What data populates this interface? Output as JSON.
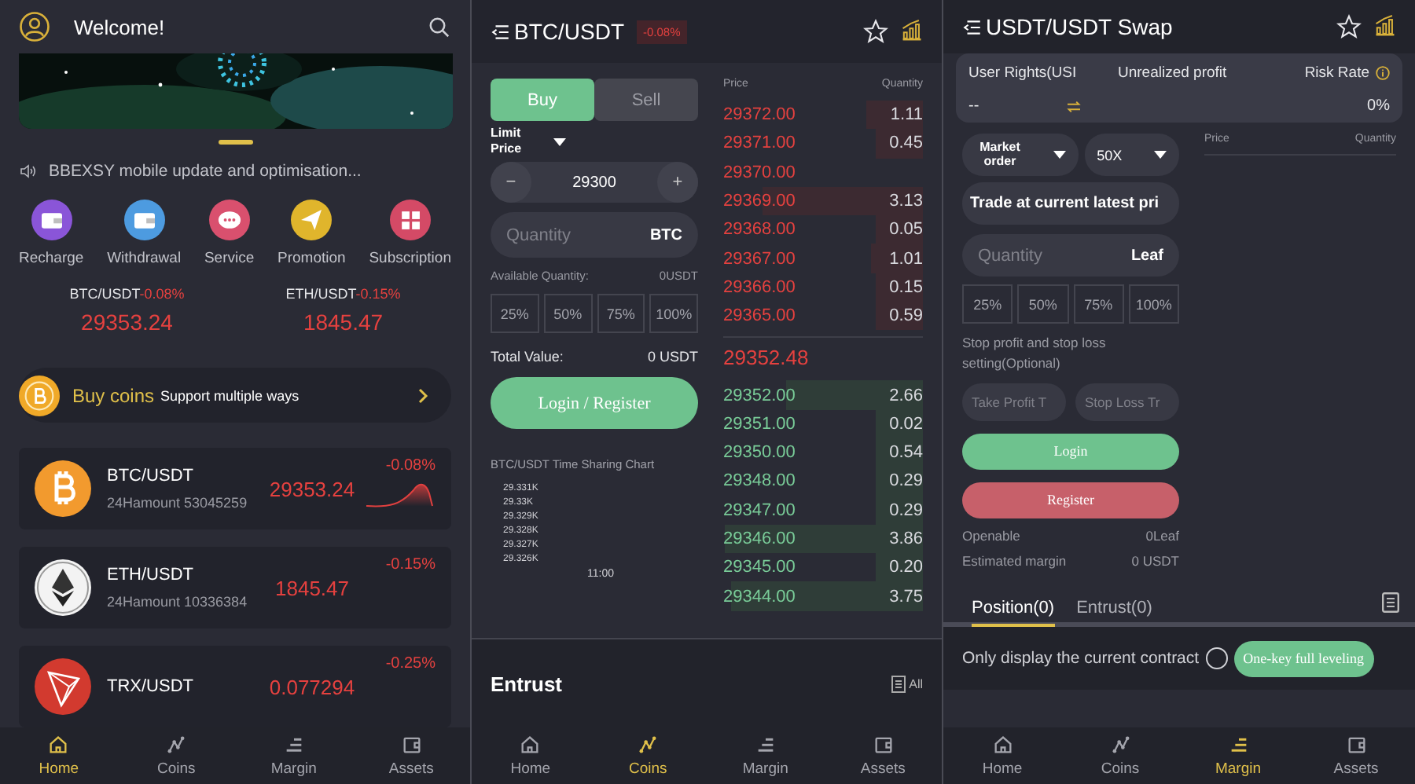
{
  "home": {
    "title": "Welcome!",
    "notice": "BBEXSY mobile update and optimisation...",
    "shortcuts": [
      {
        "label": "Recharge",
        "color": "#8a55d8",
        "kind": "wallet"
      },
      {
        "label": "Withdrawal",
        "color": "#4d9be0",
        "kind": "wallet"
      },
      {
        "label": "Service",
        "color": "#d9506e",
        "kind": "chat"
      },
      {
        "label": "Promotion",
        "color": "#e0b52c",
        "kind": "send"
      },
      {
        "label": "Subscription",
        "color": "#d44a66",
        "kind": "grid"
      }
    ],
    "tickers": [
      {
        "pair": "BTC/USDT",
        "change": "-0.08%",
        "price": "29353.24"
      },
      {
        "pair": "ETH/USDT",
        "change": "-0.15%",
        "price": "1845.47"
      }
    ],
    "promo": {
      "title": "Buy coins",
      "subtitle": "Support multiple ways"
    },
    "markets": [
      {
        "kind": "btc",
        "pair": "BTC/USDT",
        "volume": "24Hamount 53045259",
        "price": "29353.24",
        "change": "-0.08%",
        "sparkline": true
      },
      {
        "kind": "eth",
        "pair": "ETH/USDT",
        "volume": "24Hamount 10336384",
        "price": "1845.47",
        "change": "-0.15%",
        "sparkline": false
      },
      {
        "kind": "trx",
        "pair": "TRX/USDT",
        "price": "0.077294",
        "change": "-0.25%",
        "sparkline": false
      }
    ],
    "nav": [
      {
        "label": "Home",
        "selected": true
      },
      {
        "label": "Coins",
        "selected": false
      },
      {
        "label": "Margin",
        "selected": false
      },
      {
        "label": "Assets",
        "selected": false
      }
    ]
  },
  "trade": {
    "title": "BTC/USDT",
    "change": "-0.08%",
    "sides": [
      {
        "label": "Buy",
        "selected": true
      },
      {
        "label": "Sell",
        "selected": false
      }
    ],
    "order_type": "Limit Price",
    "stepper": {
      "minus": "−",
      "value": "29300",
      "plus": "+"
    },
    "quantity": {
      "placeholder": "Quantity",
      "unit": "BTC"
    },
    "available": {
      "label": "Available Quantity:",
      "value": "0USDT"
    },
    "percents": [
      "25%",
      "50%",
      "75%",
      "100%"
    ],
    "total": {
      "label": "Total Value:",
      "value": "0 USDT"
    },
    "login_button": "Login / Register",
    "chart": {
      "title": "BTC/USDT Time Sharing Chart",
      "y_labels": [
        "29.331K",
        "29.33K",
        "29.329K",
        "29.328K",
        "29.327K",
        "29.326K"
      ],
      "x_labels": [
        "11:00"
      ]
    },
    "book": {
      "price_header": "Price",
      "quantity_header": "Quantity",
      "asks": [
        {
          "price": "29372.00",
          "quantity": "1.11"
        },
        {
          "price": "29371.00",
          "quantity": "0.45"
        },
        {
          "price": "29370.00"
        },
        {
          "price": "29369.00",
          "quantity": "3.13"
        },
        {
          "price": "29368.00",
          "quantity": "0.05"
        },
        {
          "price": "29367.00",
          "quantity": "1.01"
        },
        {
          "price": "29366.00",
          "quantity": "0.15"
        },
        {
          "price": "29365.00",
          "quantity": "0.59"
        }
      ],
      "last_price": "29352.48",
      "bids": [
        {
          "price": "29352.00",
          "quantity": "2.66"
        },
        {
          "price": "29351.00",
          "quantity": "0.02"
        },
        {
          "price": "29350.00",
          "quantity": "0.54"
        },
        {
          "price": "29348.00",
          "quantity": "0.29"
        },
        {
          "price": "29347.00",
          "quantity": "0.29"
        },
        {
          "price": "29346.00",
          "quantity": "3.86"
        },
        {
          "price": "29345.00",
          "quantity": "0.20"
        },
        {
          "price": "29344.00",
          "quantity": "3.75"
        }
      ]
    },
    "entrust": {
      "title": "Entrust",
      "all": "All"
    },
    "nav": [
      {
        "label": "Home",
        "selected": false
      },
      {
        "label": "Coins",
        "selected": true
      },
      {
        "label": "Margin",
        "selected": false
      },
      {
        "label": "Assets",
        "selected": false
      }
    ]
  },
  "swap": {
    "title": "USDT/USDT Swap",
    "account": {
      "columns": [
        "User Rights(USI",
        "Unrealized profit",
        "Risk Rate"
      ],
      "rights": "--",
      "risk": "0%"
    },
    "order_type": "Market order",
    "leverage": "50X",
    "price_field": "Trade at current latest pri",
    "quantity": {
      "placeholder": "Quantity",
      "unit": "Leaf"
    },
    "percents": [
      "25%",
      "50%",
      "75%",
      "100%"
    ],
    "stop_note": "Stop profit and stop loss setting(Optional)",
    "take_profit": {
      "placeholder": "Take Profit T"
    },
    "stop_loss": {
      "placeholder": "Stop Loss Tr"
    },
    "login_button": "Login",
    "register_button": "Register",
    "stats": [
      {
        "label": "Openable",
        "value": "0Leaf"
      },
      {
        "label": "Estimated margin",
        "value": "0 USDT"
      }
    ],
    "book": {
      "price_header": "Price",
      "quantity_header": "Quantity"
    },
    "tabs": [
      {
        "label": "Position(0)",
        "selected": true
      },
      {
        "label": "Entrust(0)",
        "selected": false
      }
    ],
    "filter": {
      "label": "Only display the current contract",
      "checked": false
    },
    "close_all_button": "One-key full leveling",
    "nav": [
      {
        "label": "Home",
        "selected": false
      },
      {
        "label": "Coins",
        "selected": false
      },
      {
        "label": "Margin",
        "selected": true
      },
      {
        "label": "Assets",
        "selected": false
      }
    ]
  }
}
